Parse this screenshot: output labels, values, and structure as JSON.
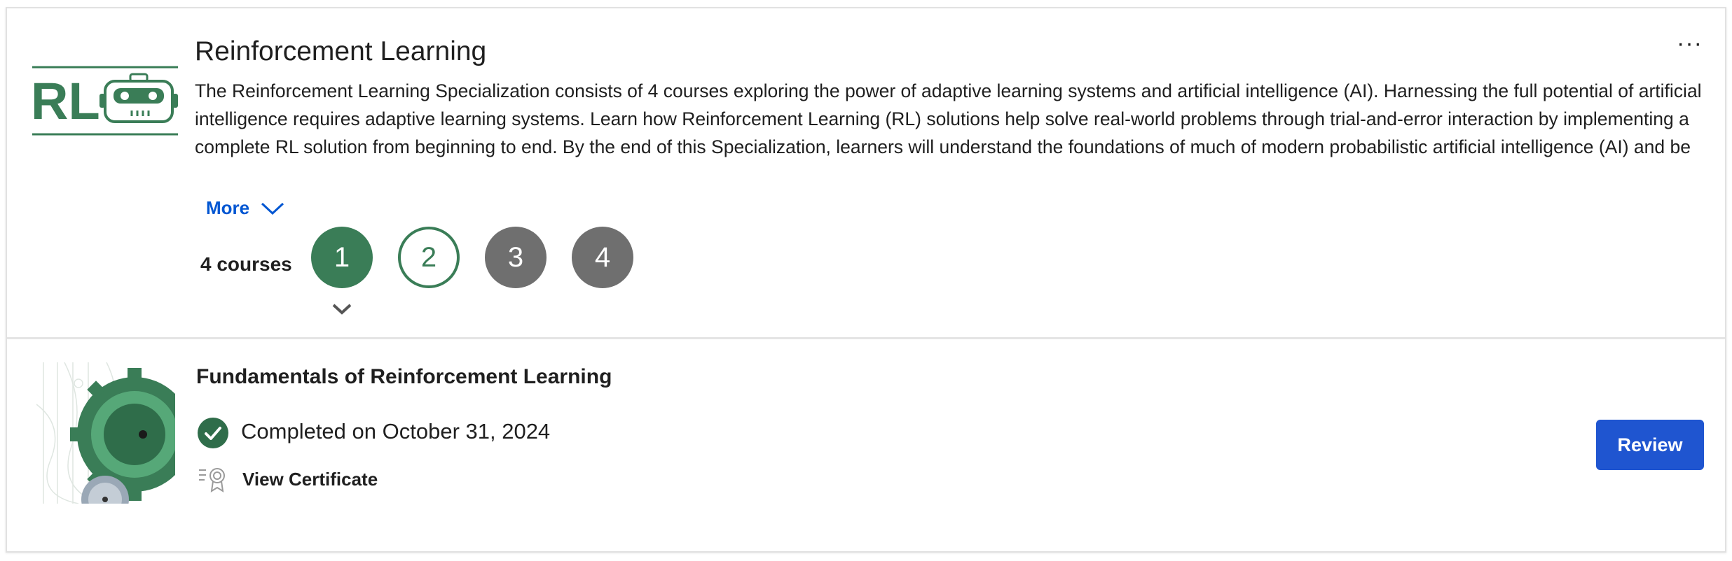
{
  "specialization": {
    "title": "Reinforcement Learning",
    "description": "The Reinforcement Learning Specialization consists of 4 courses exploring the power of adaptive learning systems and artificial intelligence (AI). Harnessing the full potential of artificial intelligence requires adaptive learning systems. Learn how Reinforcement Learning (RL) solutions help solve real-world problems through trial-and-error interaction by implementing a complete RL solution from beginning to end. By the end of this Specialization, learners will understand the foundations of much of modern probabilistic artificial intelligence (AI) and be",
    "more_label": "More",
    "logo_text": "RL",
    "menu_label": "···",
    "courses_count_label": "4 courses",
    "steps": [
      "1",
      "2",
      "3",
      "4"
    ],
    "selected_step": "1"
  },
  "course": {
    "title": "Fundamentals of Reinforcement Learning",
    "status_text": "Completed on October 31, 2024",
    "certificate_label": "View Certificate",
    "review_label": "Review"
  },
  "colors": {
    "brand_green": "#3a7d57",
    "button_blue": "#1f55d0",
    "link_blue": "#0056d2",
    "locked_gray": "#6f6f6f"
  },
  "icons": [
    "rl-logo",
    "more-options-icon",
    "chevron-down-icon",
    "check-circle-icon",
    "certificate-icon",
    "gear-thumbnail"
  ]
}
